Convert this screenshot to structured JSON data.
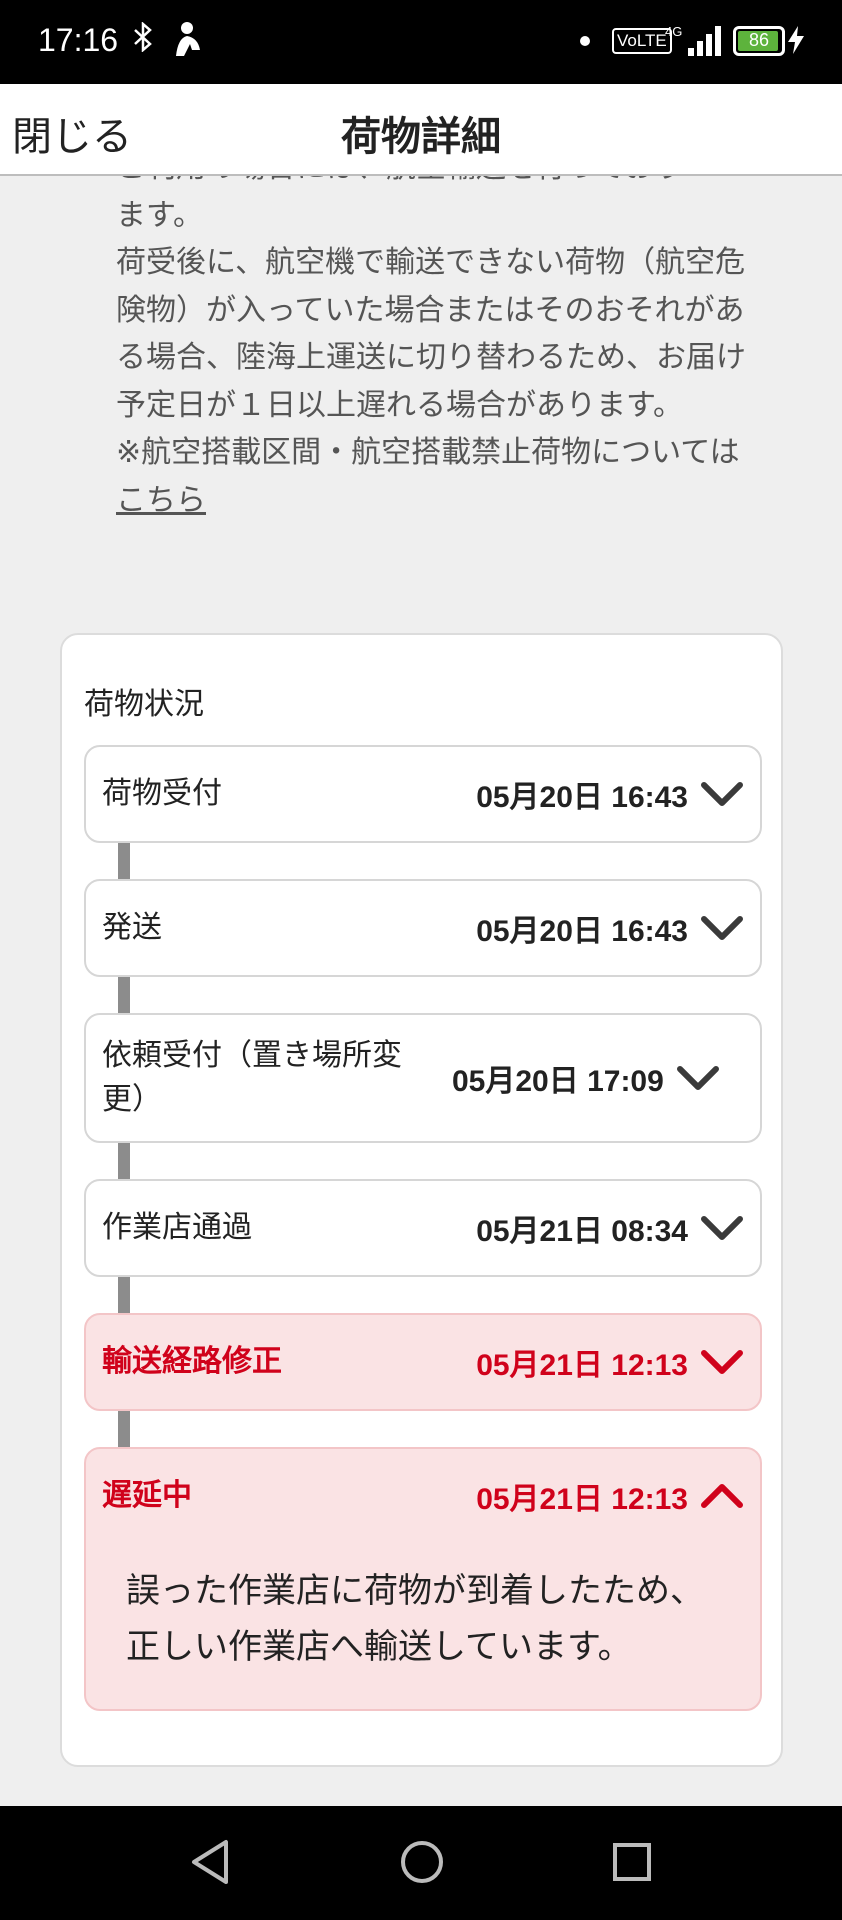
{
  "status_bar": {
    "time": "17:16",
    "network": "VoLTE",
    "network_gen": "4G",
    "battery_level": "86",
    "icons": [
      "bluetooth-icon",
      "notification-icon",
      "signal-icon",
      "battery-icon",
      "charging-icon"
    ]
  },
  "header": {
    "close_label": "閉じる",
    "title": "荷物詳細"
  },
  "notice": {
    "line0": "ご利用の場合には、航空輸送を行っており",
    "line1": "ます。",
    "paragraph": "荷受後に、航空機で輸送できない荷物（航空危険物）が入っていた場合またはそのおそれがある場合、陸海上運送に切り替わるため、お届け予定日が１日以上遅れる場合があります。",
    "note_prefix": "※航空搭載区間・航空搭載禁止荷物について",
    "note_pre_link": "は",
    "link": "こちら"
  },
  "tracking": {
    "title": "荷物状況",
    "items": [
      {
        "status": "荷物受付",
        "datetime": "05月20日 16:43"
      },
      {
        "status": "発送",
        "datetime": "05月20日 16:43"
      },
      {
        "status": "依頼受付（置き場所変更）",
        "datetime": "05月20日 17:09"
      },
      {
        "status": "作業店通過",
        "datetime": "05月21日 08:34"
      },
      {
        "status": "輸送経路修正",
        "datetime": "05月21日 12:13"
      },
      {
        "status": "遅延中",
        "datetime": "05月21日 12:13",
        "detail": "誤った作業店に荷物が到着したため、正しい作業店へ輸送しています。"
      }
    ]
  },
  "colors": {
    "alert_text": "#d0021b",
    "alert_bg": "#fae3e4",
    "connector": "#8c8c8c",
    "page_bg": "#efefef"
  },
  "nav_bar": {
    "buttons": [
      "back-icon",
      "home-icon",
      "recents-icon"
    ]
  }
}
